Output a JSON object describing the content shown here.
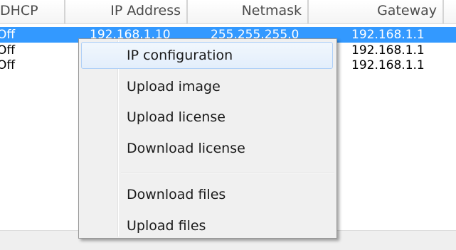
{
  "list": {
    "columns": {
      "dhcp": "DHCP",
      "ip": "IP Address",
      "netmask": "Netmask",
      "gateway": "Gateway"
    },
    "rows": [
      {
        "dhcp": "Off",
        "ip": "192.168.1.10",
        "netmask": "255.255.255.0",
        "gateway": "192.168.1.1"
      },
      {
        "dhcp": "Off",
        "ip": "",
        "netmask": "",
        "gateway": "192.168.1.1"
      },
      {
        "dhcp": "Off",
        "ip": "",
        "netmask": "",
        "gateway": "192.168.1.1"
      }
    ]
  },
  "context_menu": {
    "items": [
      {
        "label": "IP configuration"
      },
      {
        "label": "Upload image"
      },
      {
        "label": "Upload license"
      },
      {
        "label": "Download license"
      },
      {
        "label": "Download files"
      },
      {
        "label": "Upload files"
      }
    ]
  },
  "colors": {
    "selection": "#3399ff",
    "menu_background": "#f0f0f0",
    "menu_hover_border": "#aecff7"
  }
}
